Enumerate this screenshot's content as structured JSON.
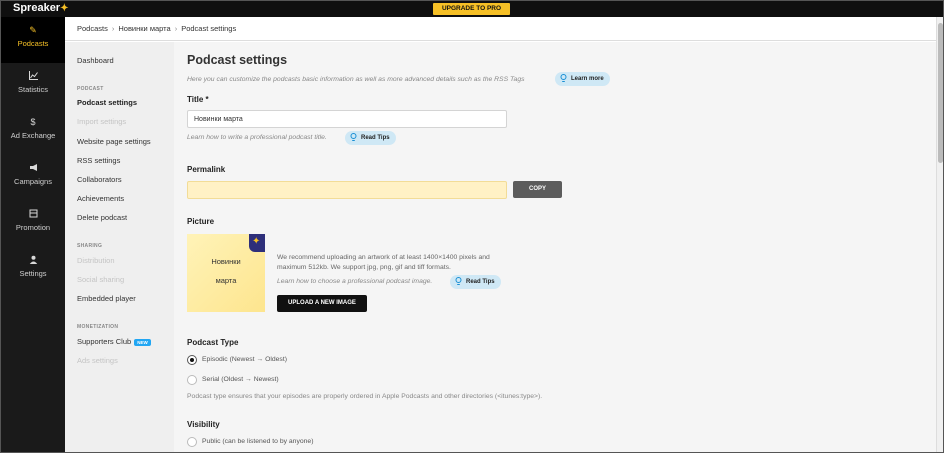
{
  "app": {
    "logo_text": "Spreaker",
    "upgrade_label": "UPGRADE TO PRO",
    "brand_color": "#f6c026"
  },
  "leftnav": [
    {
      "label": "Podcasts",
      "icon": "pen-icon",
      "active": true
    },
    {
      "label": "Statistics",
      "icon": "chart-icon"
    },
    {
      "label": "Ad Exchange",
      "icon": "dollar-icon"
    },
    {
      "label": "Campaigns",
      "icon": "megaphone-icon"
    },
    {
      "label": "Promotion",
      "icon": "store-icon"
    },
    {
      "label": "Settings",
      "icon": "person-icon"
    }
  ],
  "breadcrumb": [
    "Podcasts",
    "Новинки марта",
    "Podcast settings"
  ],
  "sidebar": {
    "dashboard": "Dashboard",
    "podcast_head": "PODCAST",
    "podcast_settings": "Podcast settings",
    "import_settings": "Import settings",
    "website_settings": "Website page settings",
    "rss_settings": "RSS settings",
    "collaborators": "Collaborators",
    "achievements": "Achievements",
    "delete": "Delete podcast",
    "sharing_head": "SHARING",
    "distribution": "Distribution",
    "social_sharing": "Social sharing",
    "embedded_player": "Embedded player",
    "monetization_head": "MONETIZATION",
    "supporters_club": "Supporters Club",
    "new_badge": "NEW",
    "ads_settings": "Ads settings"
  },
  "main": {
    "title": "Podcast settings",
    "subtitle": "Here you can customize the podcasts basic information as well as more advanced details such as the RSS Tags",
    "learn_more": "Learn more",
    "title_label": "Title",
    "title_required": "*",
    "title_value": "Новинки марта",
    "title_hint": "Learn how to write a professional podcast title.",
    "read_tips": "Read Tips",
    "permalink_label": "Permalink",
    "permalink_value": "",
    "copy_label": "COPY",
    "picture_label": "Picture",
    "cover_line1": "Новинки",
    "cover_line2": "марта",
    "picture_text1": "We recommend uploading an artwork of at least 1400×1400 pixels and",
    "picture_text2": "maximum 512kb. We support jpg, png, gif and tiff formats.",
    "picture_hint": "Learn how to choose a professional podcast image.",
    "upload_label": "UPLOAD A NEW IMAGE",
    "type_label": "Podcast Type",
    "type_options": [
      "Episodic (Newest → Oldest)",
      "Serial (Oldest → Newest)"
    ],
    "type_selected": 0,
    "type_note": "Podcast type ensures that your episodes are properly ordered in Apple Podcasts and other directories (<itunes:type>).",
    "visibility_label": "Visibility",
    "visibility_option": "Public (can be listened to by anyone)"
  }
}
